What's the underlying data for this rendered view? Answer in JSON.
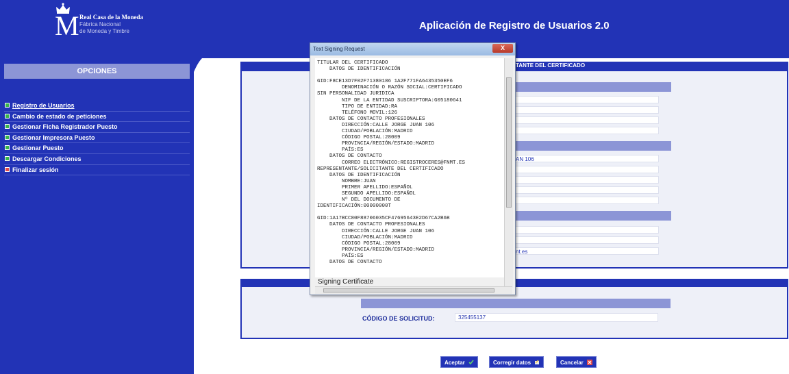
{
  "header": {
    "logo_line1": "Real Casa de la Moneda",
    "logo_line2": "Fábrica Nacional",
    "logo_line3": "de Moneda y Timbre",
    "logo_letter": "M",
    "app_title": "Aplicación de Registro de Usuarios 2.0"
  },
  "sidebar": {
    "title": "OPCIONES",
    "items": [
      {
        "label": "Registro de Usuarios"
      },
      {
        "label": "Cambio de estado de peticiones"
      },
      {
        "label": "Gestionar Ficha Registrador Puesto"
      },
      {
        "label": "Gestionar Impresora Puesto"
      },
      {
        "label": "Gestionar Puesto"
      },
      {
        "label": "Descargar Condiciones"
      },
      {
        "label": "Finalizar sesión"
      }
    ]
  },
  "form": {
    "section_header": "TANTE DEL CERTIFICADO",
    "address_partial": "AN 106",
    "email_partial": "nt.es",
    "solicitud_label": "CÓDIGO DE SOLICITUD:",
    "solicitud_value": "325455137"
  },
  "buttons": {
    "accept": "Aceptar",
    "correct": "Corregir datos",
    "cancel": "Cancelar"
  },
  "dialog": {
    "title": "Text Signing Request",
    "close": "X",
    "footer_label": "Signing Certificate",
    "content": "TITULAR DEL CERTIFICADO\n    DATOS DE IDENTIFICACIÓN\n\nGID:F8CE13D7F02F71380186 1A2F771FA6435350EF6\n        DENOMINACIÓN O RAZÓN SOCIAL:CERTIFICADO\nSIN PERSONALIDAD JURIDICA\n        NIF DE LA ENTIDAD SUSCRIPTORA:G05180641\n        TIPO DE ENTIDAD:RA\n        TELÉFONO MOVIL:126\n    DATOS DE CONTACTO PROFESIONALES\n        DIRECCIÓN:CALLE JORGE JUAN 106\n        CIUDAD/POBLACIÓN:MADRID\n        CÓDIGO POSTAL:28009\n        PROVINCIA/REGIÓN/ESTADO:MADRID\n        PAÍS:ES\n    DATOS DE CONTACTO\n        CORREO ELECTRÓNICO:REGISTROCERES@FNMT.ES\nREPRESENTANTE/SOLICITANTE DEL CERTIFICADO\n    DATOS DE IDENTIFICACIÓN\n        NOMBRE:JUAN\n        PRIMER APELLIDO:ESPAÑOL\n        SEGUNDO APELLIDO:ESPAÑOL\n        Nº DEL DOCUMENTO DE\nIDENTIFICACIÓN:00000000T\n\nGID:1A17BCC80F88706035CF47695643E2D67CA2B6B\n    DATOS DE CONTACTO PROFESIONALES\n        DIRECCIÓN:CALLE JORGE JUAN 106\n        CIUDAD/POBLACIÓN:MADRID\n        CÓDIGO POSTAL:28009\n        PROVINCIA/REGIÓN/ESTADO:MADRID\n        PAÍS:ES\n    DATOS DE CONTACTO"
  },
  "colors": {
    "primary_blue": "#2233b6",
    "menu_icon_green": "#38b54a",
    "menu_icon_red": "#e04a4a",
    "section_bar": "#8c95d6"
  }
}
